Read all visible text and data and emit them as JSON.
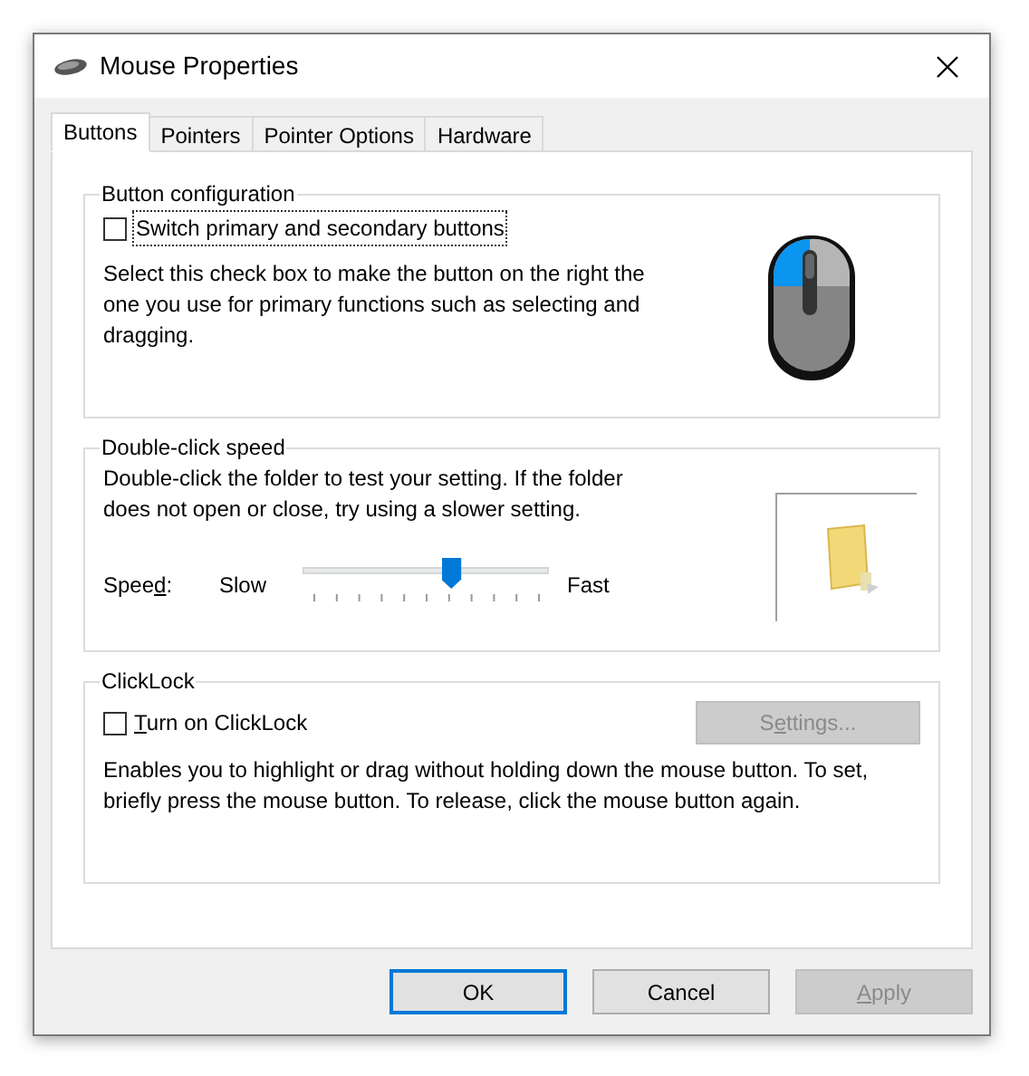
{
  "window": {
    "title": "Mouse Properties"
  },
  "tabs": [
    {
      "label": "Buttons",
      "selected": true
    },
    {
      "label": "Pointers",
      "selected": false
    },
    {
      "label": "Pointer Options",
      "selected": false
    },
    {
      "label": "Hardware",
      "selected": false
    }
  ],
  "button_configuration": {
    "title": "Button configuration",
    "checkbox": {
      "label": "Switch primary and secondary buttons",
      "checked": false,
      "focused": true
    },
    "description": "Select this check box to make the button on the right the one you use for primary functions such as selecting and dragging."
  },
  "double_click_speed": {
    "title": "Double-click speed",
    "description": "Double-click the folder to test your setting. If the folder does not open or close, try using a slower setting.",
    "speed_label": {
      "before": "Spee",
      "key": "d",
      "after": ":"
    },
    "slow_label": "Slow",
    "fast_label": "Fast",
    "slider": {
      "level": 0.6
    }
  },
  "clicklock": {
    "title": "ClickLock",
    "checkbox": {
      "label": {
        "key": "T",
        "after": "urn on ClickLock"
      },
      "checked": false
    },
    "settings_button": {
      "label": {
        "before": "S",
        "key": "e",
        "after": "ttings..."
      },
      "disabled": true
    },
    "description": "Enables you to highlight or drag without holding down the mouse button. To set, briefly press the mouse button. To release, click the mouse button again."
  },
  "buttons": [
    {
      "label": {
        "after": "OK"
      },
      "default": true,
      "disabled": false
    },
    {
      "label": {
        "after": "Cancel"
      },
      "default": false,
      "disabled": false
    },
    {
      "label": {
        "key": "A",
        "after": "pply"
      },
      "default": false,
      "disabled": true
    }
  ]
}
